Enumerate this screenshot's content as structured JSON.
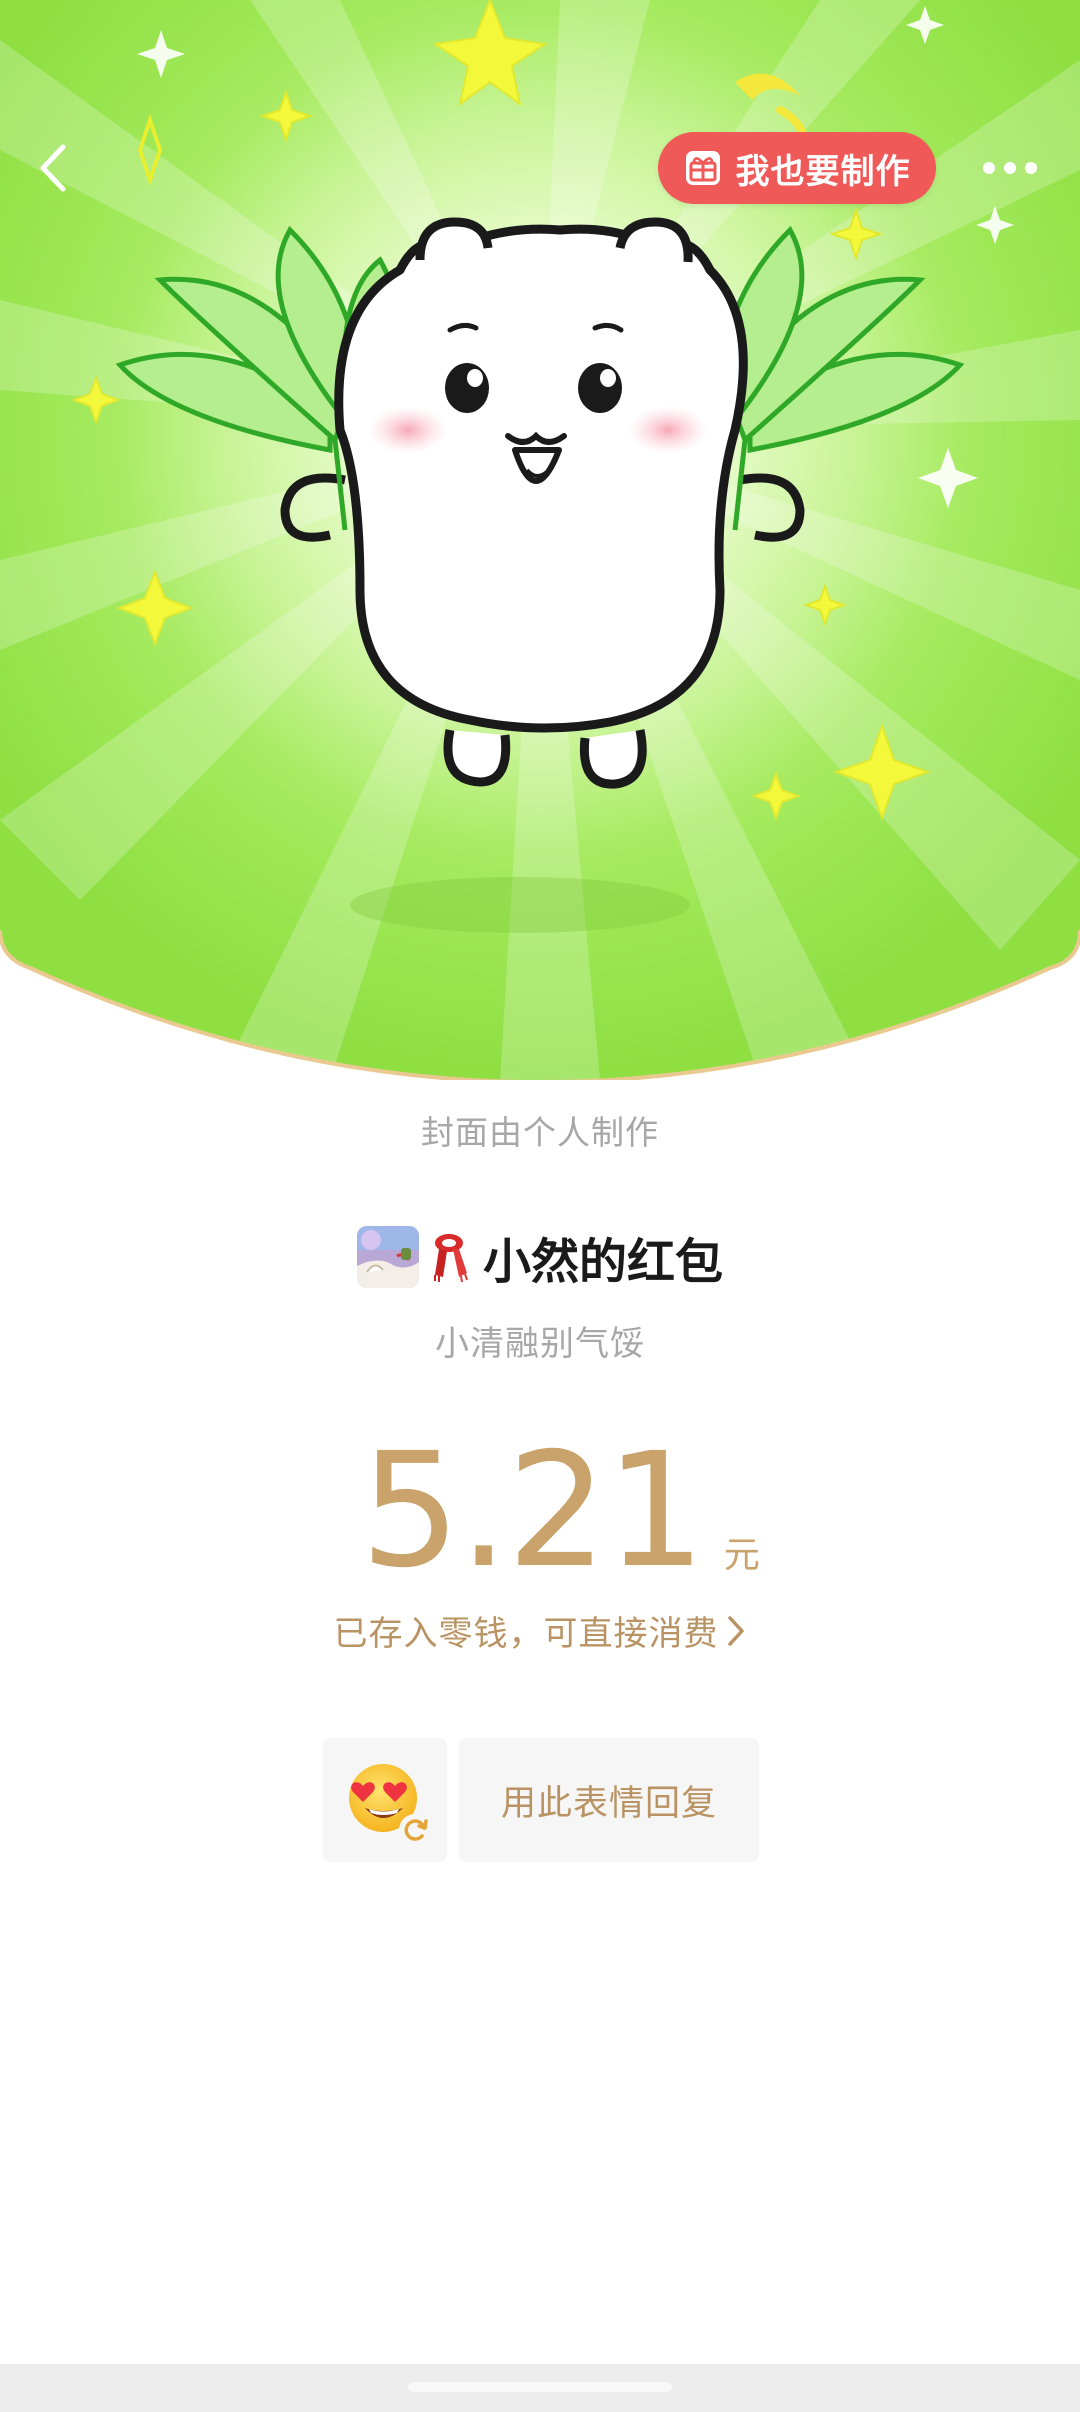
{
  "header": {
    "make_button_label": "我也要制作"
  },
  "cover": {
    "credit_text": "封面由个人制作"
  },
  "sender": {
    "name": "小然的红包",
    "greeting": "小清融别气馁"
  },
  "packet": {
    "amount": "5.21",
    "unit": "元",
    "deposit_text": "已存入零钱，可直接消费"
  },
  "reply": {
    "button_label": "用此表情回复"
  },
  "colors": {
    "gold": "#c9a36b",
    "red": "#ef5a58",
    "green_bg": "#9be84f"
  },
  "icons": [
    "back-arrow-icon",
    "gift-icon",
    "more-icon",
    "scarf-icon",
    "heart-eyes-emoji-icon",
    "refresh-icon",
    "chevron-right-icon"
  ]
}
